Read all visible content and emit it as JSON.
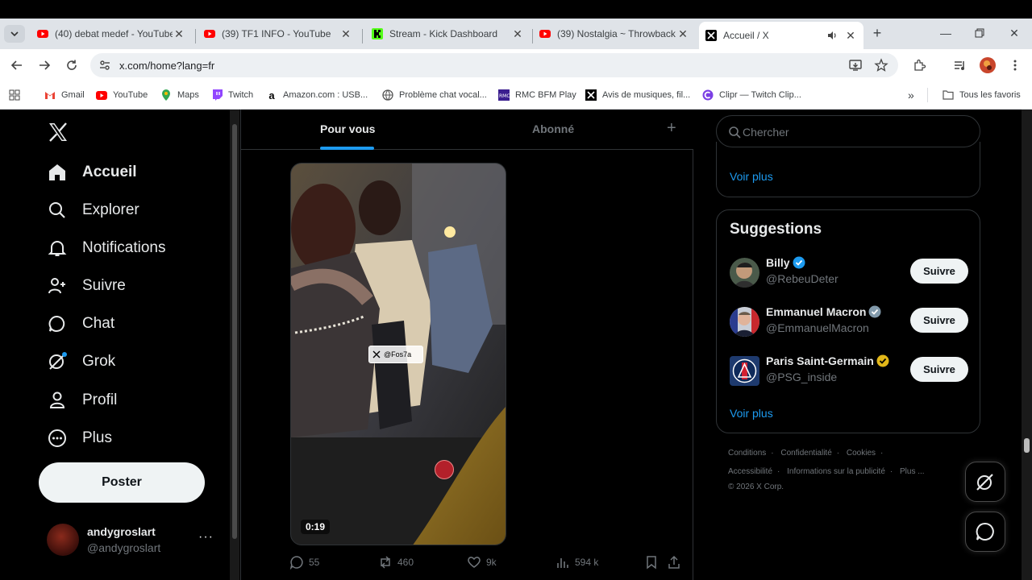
{
  "browser": {
    "tabs": [
      {
        "title": "(40) debat medef - YouTube",
        "icon": "youtube-icon"
      },
      {
        "title": "(39) TF1 INFO - YouTube",
        "icon": "youtube-icon"
      },
      {
        "title": "Stream - Kick Dashboard",
        "icon": "kick-icon"
      },
      {
        "title": "(39) Nostalgia ~ Throwback",
        "icon": "youtube-icon"
      },
      {
        "title": "Accueil / X",
        "icon": "x-icon",
        "active": true
      }
    ],
    "url": "x.com/home?lang=fr",
    "bookmarks": [
      {
        "label": "Gmail",
        "icon": "gmail-icon"
      },
      {
        "label": "YouTube",
        "icon": "youtube-icon"
      },
      {
        "label": "Maps",
        "icon": "maps-icon"
      },
      {
        "label": "Twitch",
        "icon": "twitch-icon"
      },
      {
        "label": "Amazon.com : USB...",
        "icon": "amazon-icon"
      },
      {
        "label": "Problème chat vocal...",
        "icon": "globe-icon"
      },
      {
        "label": "RMC BFM Play",
        "icon": "rmc-icon"
      },
      {
        "label": "Avis de musiques, fil...",
        "icon": "x-icon"
      },
      {
        "label": "Clipr — Twitch Clip...",
        "icon": "clipr-icon"
      }
    ],
    "bookmarks_more": "»",
    "all_bookmarks": "Tous les favoris"
  },
  "sidebar": {
    "nav": [
      {
        "label": "Accueil",
        "icon": "home-icon",
        "active": true
      },
      {
        "label": "Explorer",
        "icon": "search-icon"
      },
      {
        "label": "Notifications",
        "icon": "bell-icon"
      },
      {
        "label": "Suivre",
        "icon": "add-user-icon"
      },
      {
        "label": "Chat",
        "icon": "chat-icon"
      },
      {
        "label": "Grok",
        "icon": "grok-icon"
      },
      {
        "label": "Profil",
        "icon": "profile-icon"
      },
      {
        "label": "Plus",
        "icon": "more-circle-icon"
      }
    ],
    "post_label": "Poster",
    "account": {
      "name": "andygroslart",
      "handle": "@andygroslart",
      "more": "···"
    }
  },
  "timeline": {
    "tabs": [
      {
        "label": "Pour vous",
        "active": true
      },
      {
        "label": "Abonné",
        "active": false
      }
    ],
    "add_label": "+",
    "video": {
      "duration": "0:19",
      "watermark": "@Fos7a"
    },
    "actions": [
      {
        "icon": "reply-icon",
        "count": "55"
      },
      {
        "icon": "repost-icon",
        "count": "460"
      },
      {
        "icon": "like-icon",
        "count": "9k"
      },
      {
        "icon": "views-icon",
        "count": "594 k"
      }
    ]
  },
  "right": {
    "search_placeholder": "Chercher",
    "top_card_more": "Voir plus",
    "suggestions_title": "Suggestions",
    "suggestions": [
      {
        "name": "Billy",
        "handle": "@RebeuDeter",
        "badge": "blue",
        "follow": "Suivre"
      },
      {
        "name": "Emmanuel Macron",
        "handle": "@EmmanuelMacron",
        "badge": "gray",
        "follow": "Suivre"
      },
      {
        "name": "Paris Saint-Germain",
        "handle": "@PSG_inside",
        "badge": "gold",
        "follow": "Suivre"
      }
    ],
    "suggestions_more": "Voir plus",
    "footer": {
      "line1": [
        "Conditions",
        "Confidentialité",
        "Cookies"
      ],
      "line2": [
        "Accessibilité",
        "Informations sur la publicité",
        "Plus ..."
      ],
      "copyright": "© 2026 X Corp."
    }
  },
  "colors": {
    "accent": "#1d9bf0",
    "verified_gold": "#e2b719",
    "verified_gray": "#829aab",
    "background": "#000000"
  }
}
